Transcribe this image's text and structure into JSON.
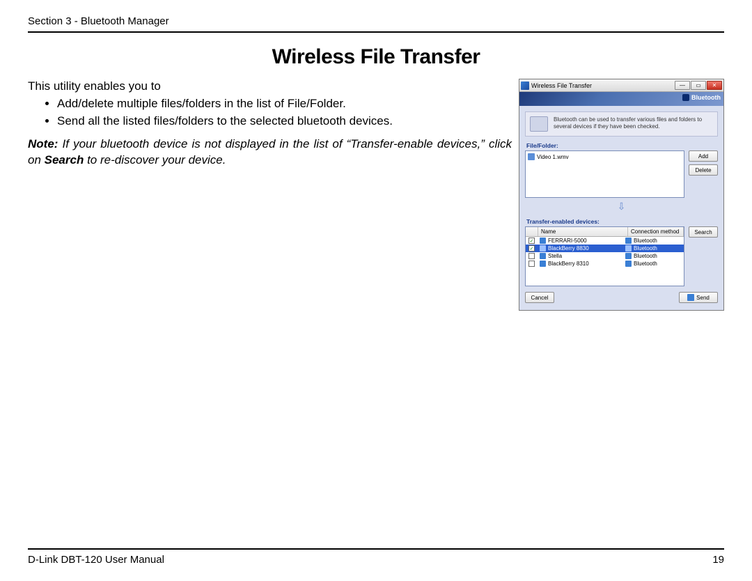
{
  "header": {
    "section": "Section 3 - Bluetooth Manager"
  },
  "title": "Wireless File Transfer",
  "intro": "This utility enables you to",
  "bullets": [
    "Add/delete multiple files/folders in the list of File/Folder.",
    "Send all the listed files/folders to the selected bluetooth devices."
  ],
  "note": {
    "label": "Note:",
    "before": " If your bluetooth device is not displayed in the list of “Transfer-enable devices,” click on ",
    "bold": "Search",
    "after": " to re-discover your device."
  },
  "dialog": {
    "title": "Wireless File Transfer",
    "badge": "Bluetooth",
    "info": "Bluetooth can be used to transfer various files and folders to several devices if they have been checked.",
    "file_label": "File/Folder:",
    "file_item": "Video 1.wmv",
    "btn_add": "Add",
    "btn_delete": "Delete",
    "devices_label": "Transfer-enabled devices:",
    "head_name": "Name",
    "head_conn": "Connection method",
    "btn_search": "Search",
    "rows": [
      {
        "checked": true,
        "selected": false,
        "name": "FERRARI-5000",
        "conn": "Bluetooth"
      },
      {
        "checked": true,
        "selected": true,
        "name": "BlackBerry 8830",
        "conn": "Bluetooth"
      },
      {
        "checked": false,
        "selected": false,
        "name": "Stella",
        "conn": "Bluetooth"
      },
      {
        "checked": false,
        "selected": false,
        "name": "BlackBerry 8310",
        "conn": "Bluetooth"
      }
    ],
    "btn_cancel": "Cancel",
    "btn_send": "Send"
  },
  "footer": {
    "left": "D-Link DBT-120 User Manual",
    "page": "19"
  }
}
